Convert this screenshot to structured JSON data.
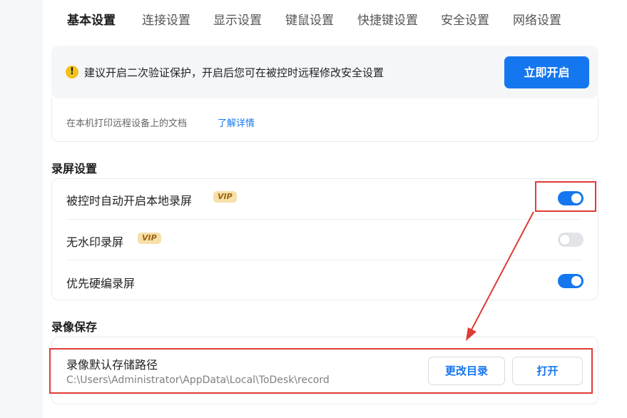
{
  "tabs": [
    {
      "label": "基本设置",
      "active": true
    },
    {
      "label": "连接设置",
      "active": false
    },
    {
      "label": "显示设置",
      "active": false
    },
    {
      "label": "键鼠设置",
      "active": false
    },
    {
      "label": "快捷键设置",
      "active": false
    },
    {
      "label": "安全设置",
      "active": false
    },
    {
      "label": "网络设置",
      "active": false
    }
  ],
  "notice": {
    "icon": "warning-icon",
    "text": "建议开启二次验证保护，开启后您可在被控时远程修改安全设置",
    "button": "立即开启"
  },
  "partial_row": {
    "text": "在本机打印远程设备上的文档",
    "link": "了解详情"
  },
  "recording": {
    "title": "录屏设置",
    "rows": [
      {
        "label": "被控时自动开启本地录屏",
        "vip": "VIP",
        "enabled": true
      },
      {
        "label": "无水印录屏",
        "vip": "VIP",
        "enabled": false
      },
      {
        "label": "优先硬编录屏",
        "vip": "",
        "enabled": true
      }
    ]
  },
  "save": {
    "title": "录像保存",
    "path_label": "录像默认存储路径",
    "path_value": "C:\\Users\\Administrator\\AppData\\Local\\ToDesk\\record",
    "change_button": "更改目录",
    "open_button": "打开"
  },
  "colors": {
    "accent": "#1577f0",
    "annotation_red": "#e03b35",
    "vip_bg": "#f7dfa8",
    "warning": "#f3c21e"
  }
}
